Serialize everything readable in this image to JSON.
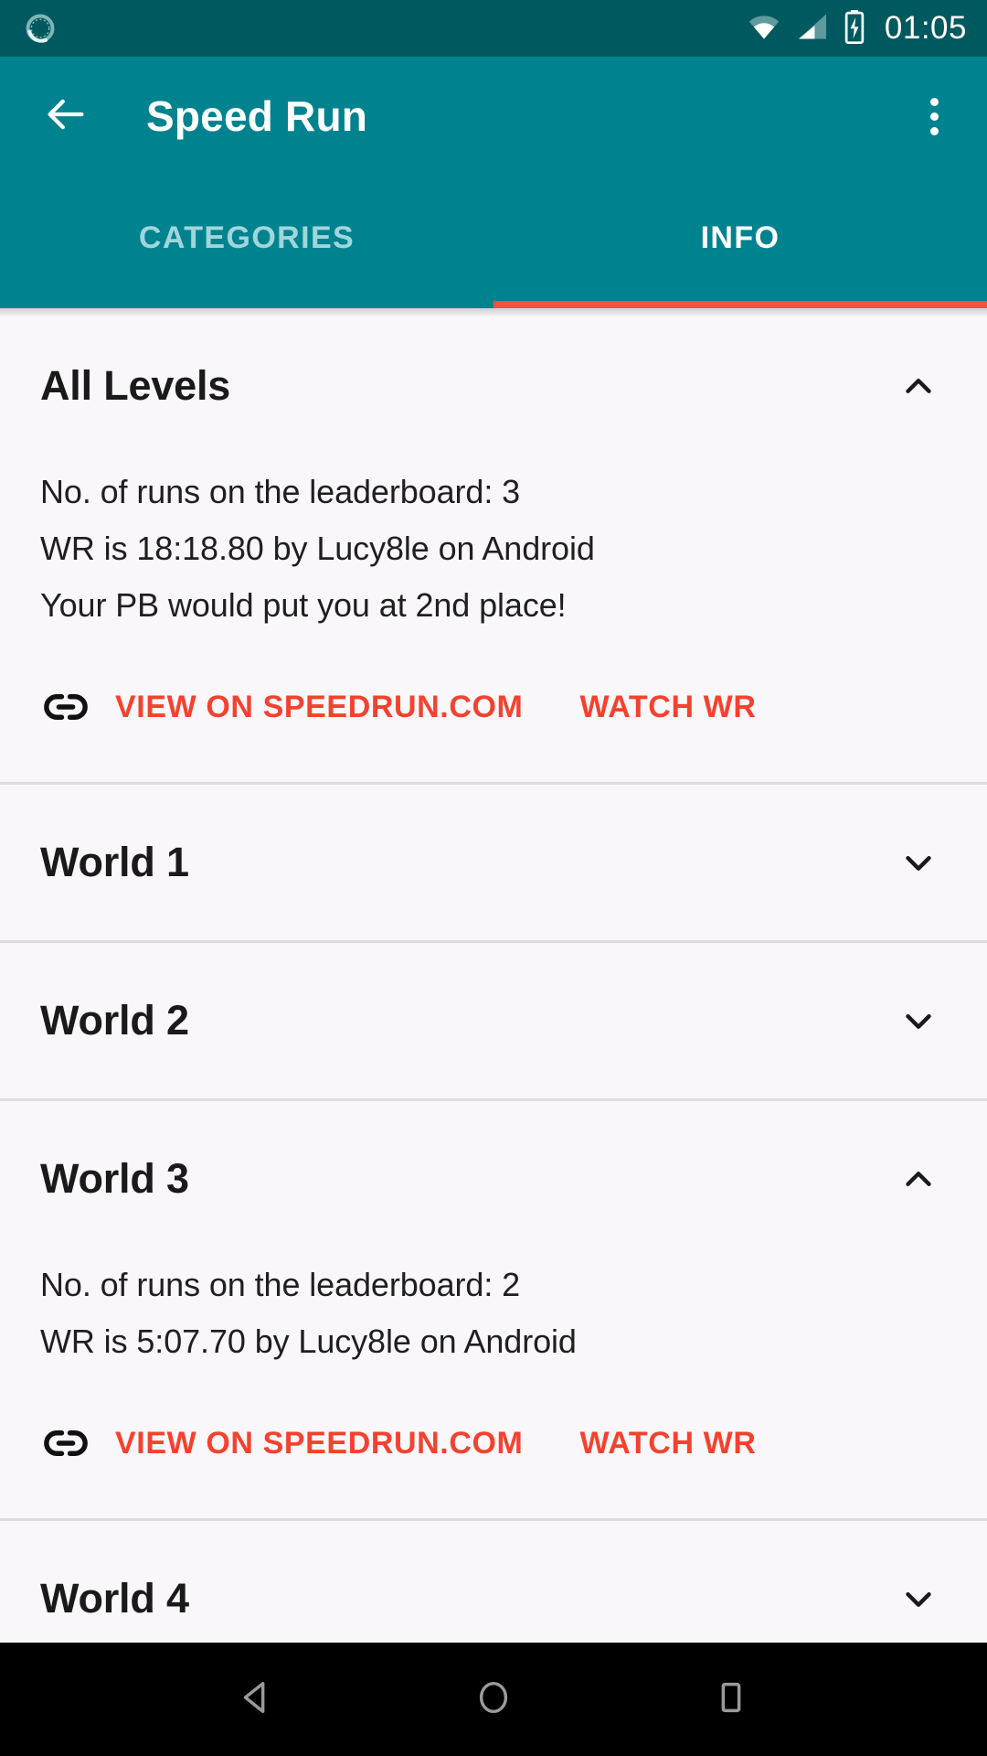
{
  "status_bar": {
    "sync_icon": "sync-indicator-icon",
    "wifi_icon": "wifi-icon",
    "signal_icon": "cellular-signal-icon",
    "battery_icon": "battery-charging-icon",
    "time": "01:05",
    "background_color": "#00595E"
  },
  "app_bar": {
    "back_icon": "back-arrow-icon",
    "title": "Speed Run",
    "overflow_icon": "more-vert-icon",
    "background_color": "#00838F"
  },
  "tabs": {
    "items": [
      {
        "label": "CATEGORIES",
        "active": false
      },
      {
        "label": "INFO",
        "active": true
      }
    ],
    "indicator_color": "#F4523F",
    "active_color": "#FFFFFF",
    "inactive_color": "#9FD6DC"
  },
  "accent_color": "#F4422F",
  "sections": [
    {
      "title": "All Levels",
      "expanded": true,
      "chevron_icon": "chevron-up-icon",
      "lines": [
        "No. of runs on the leaderboard: 3",
        "WR is 18:18.80 by Lucy8le on Android",
        "Your PB would put you at 2nd place!"
      ],
      "link_icon": "link-icon",
      "primary_action": "VIEW ON SPEEDRUN.COM",
      "secondary_action": "WATCH WR"
    },
    {
      "title": "World 1",
      "expanded": false,
      "chevron_icon": "chevron-down-icon"
    },
    {
      "title": "World 2",
      "expanded": false,
      "chevron_icon": "chevron-down-icon"
    },
    {
      "title": "World 3",
      "expanded": true,
      "chevron_icon": "chevron-up-icon",
      "lines": [
        "No. of runs on the leaderboard: 2",
        "WR is 5:07.70 by Lucy8le on Android"
      ],
      "link_icon": "link-icon",
      "primary_action": "VIEW ON SPEEDRUN.COM",
      "secondary_action": "WATCH WR"
    },
    {
      "title": "World 4",
      "expanded": false,
      "chevron_icon": "chevron-down-icon"
    }
  ],
  "nav_bar": {
    "back_icon": "nav-back-triangle-icon",
    "home_icon": "nav-home-circle-icon",
    "recents_icon": "nav-recents-square-icon",
    "background_color": "#000000"
  }
}
